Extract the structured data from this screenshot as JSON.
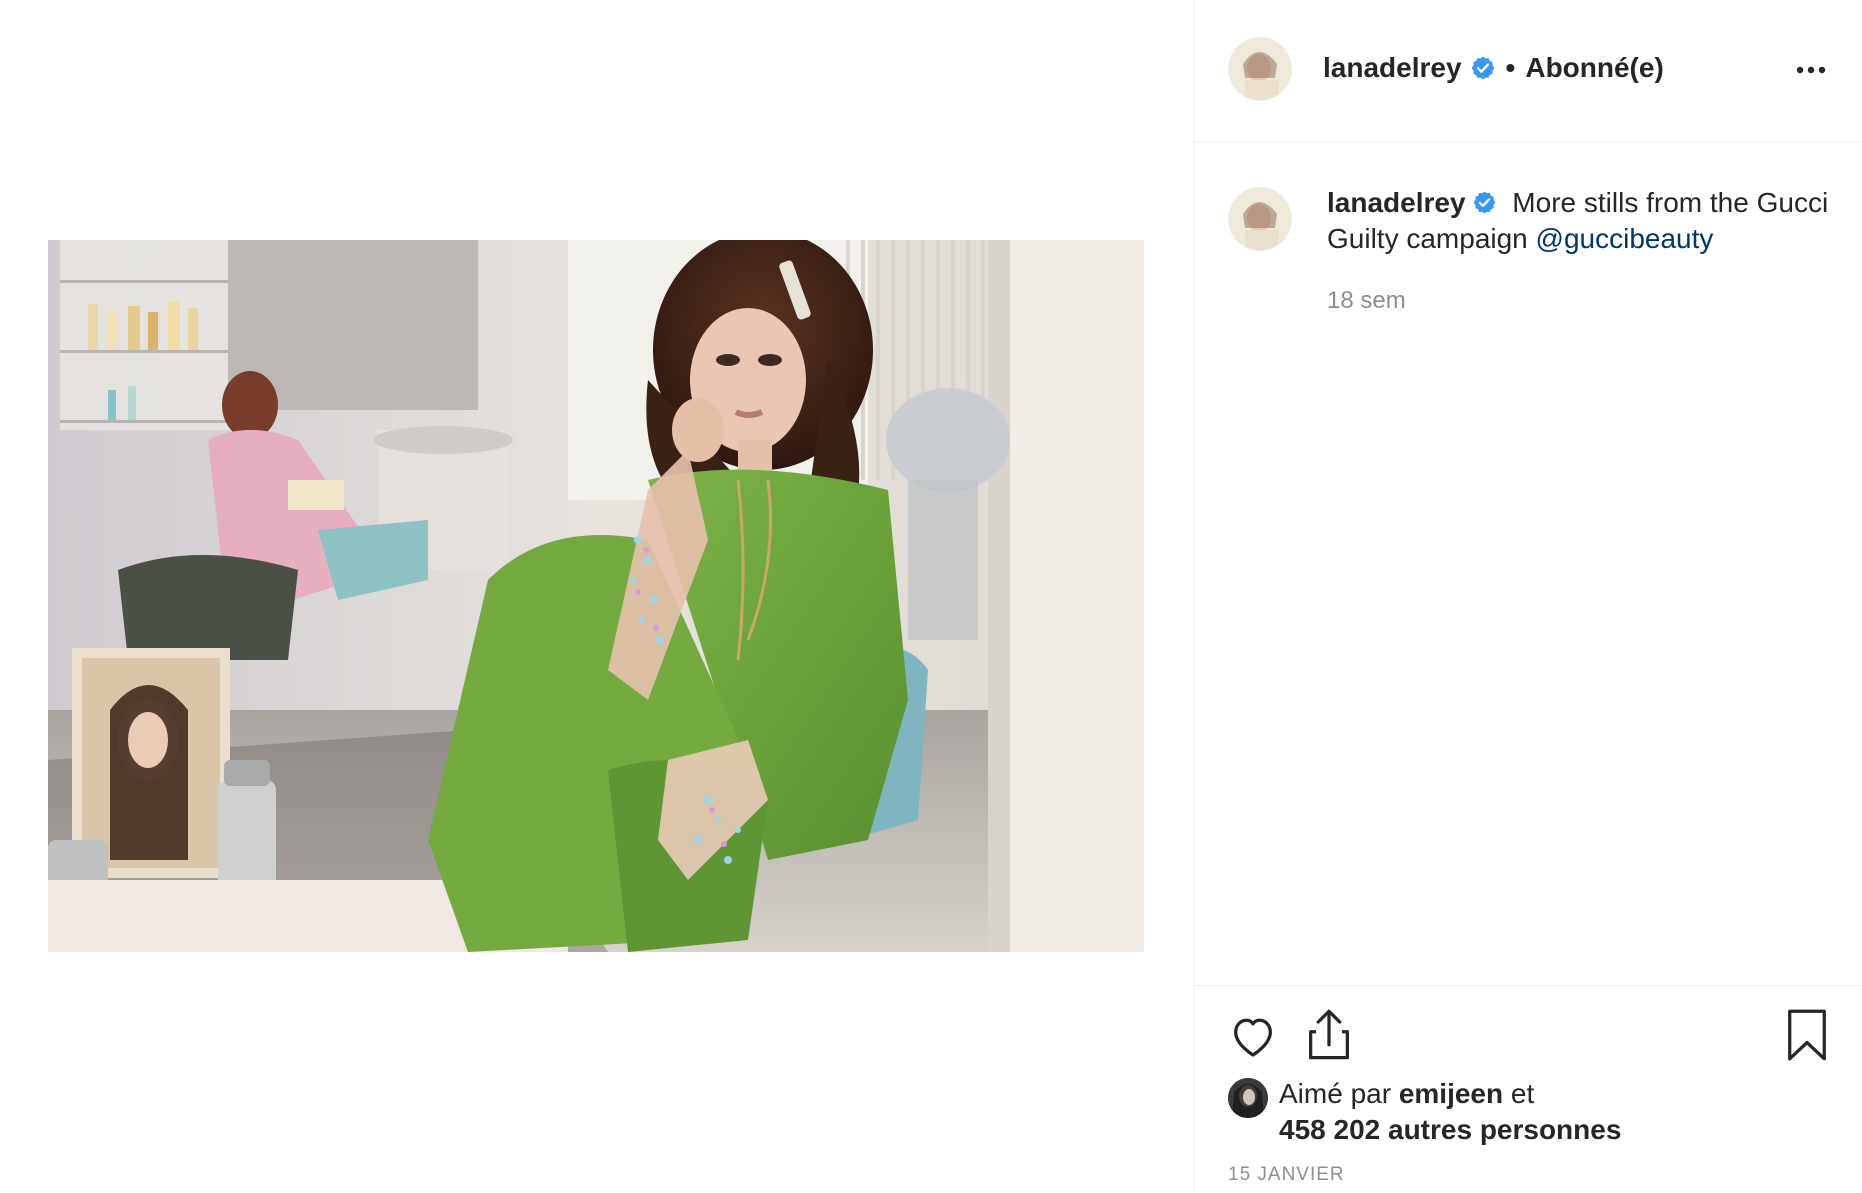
{
  "post": {
    "image_alt": "Photo: woman in green Gucci outfit seated in a salon",
    "author": {
      "username": "lanadelrey",
      "verified": true,
      "follow_status": "Abonné(e)",
      "separator": "•"
    },
    "caption": {
      "username": "lanadelrey",
      "text": " More stills from the Gucci Guilty campaign ",
      "mention": "@guccibeauty",
      "time_ago": "18 sem"
    },
    "likes": {
      "prefix": "Aimé par ",
      "liker": "emijeen",
      "suffix": " et",
      "others": "458 202 autres personnes"
    },
    "date": "15 JANVIER"
  },
  "icons": {
    "more": "more-options-icon",
    "like": "heart-icon",
    "share": "share-icon",
    "save": "bookmark-icon",
    "verified": "verified-badge-icon"
  },
  "colors": {
    "verified_blue": "#3897f0",
    "mention": "#00376b",
    "muted_text": "#8e8e8e",
    "divider": "#efefef"
  }
}
